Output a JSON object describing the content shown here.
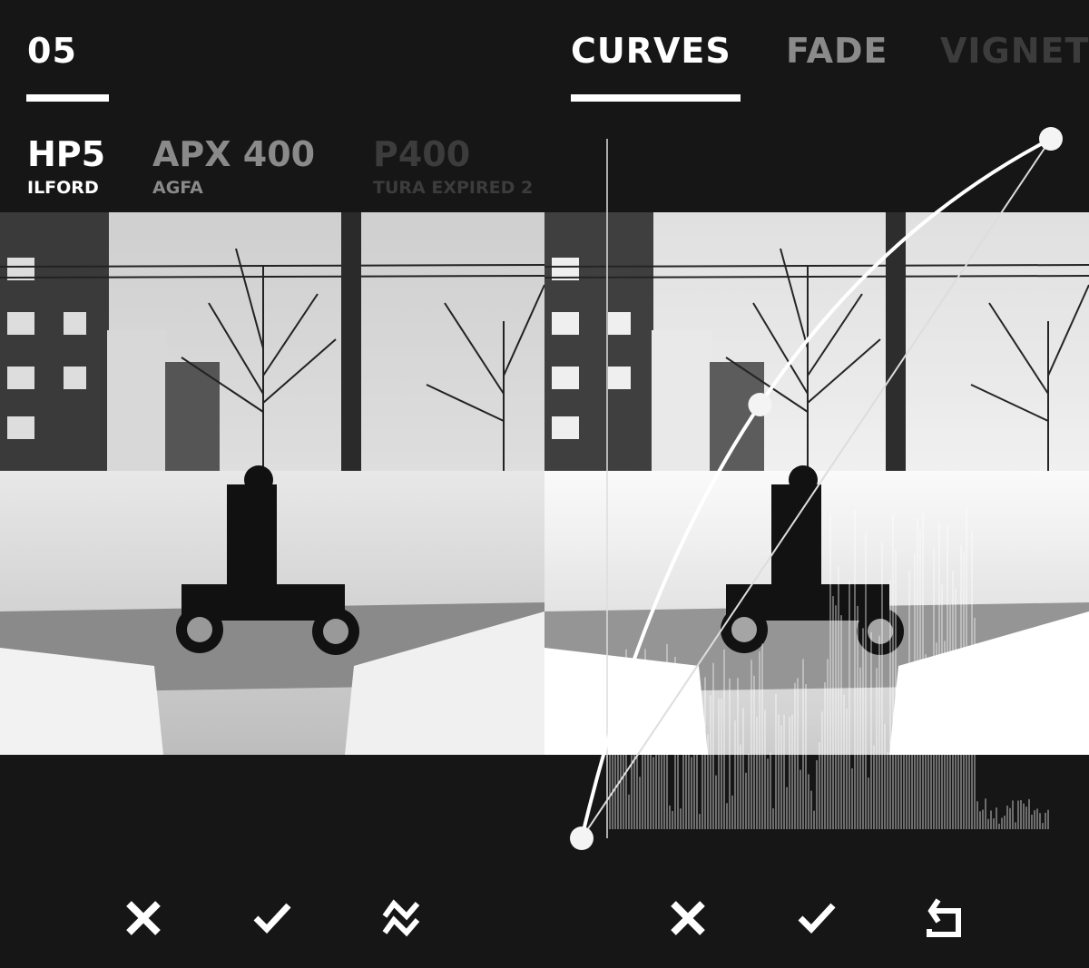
{
  "left": {
    "step_number": "05",
    "films": [
      {
        "name": "HP5",
        "brand": "ILFORD",
        "color": "#ffffff"
      },
      {
        "name": "APX 400",
        "brand": "AGFA",
        "color": "#8a8a8a"
      },
      {
        "name": "P400",
        "brand": "TURA EXPIRED 2",
        "color": "#3c3c3c"
      }
    ],
    "actions": [
      "close-icon",
      "check-icon",
      "shuffle-zigzag-icon"
    ]
  },
  "right": {
    "tabs": [
      {
        "label": "CURVES",
        "color": "#ffffff",
        "active": true
      },
      {
        "label": "FADE",
        "color": "#8a8a8a"
      },
      {
        "label": "VIGNETTE",
        "color": "#3c3c3c"
      }
    ],
    "curve_points": [
      [
        0,
        0
      ],
      [
        0.38,
        0.62
      ],
      [
        1,
        1
      ]
    ],
    "actions": [
      "close-icon",
      "check-icon",
      "reset-icon"
    ]
  }
}
